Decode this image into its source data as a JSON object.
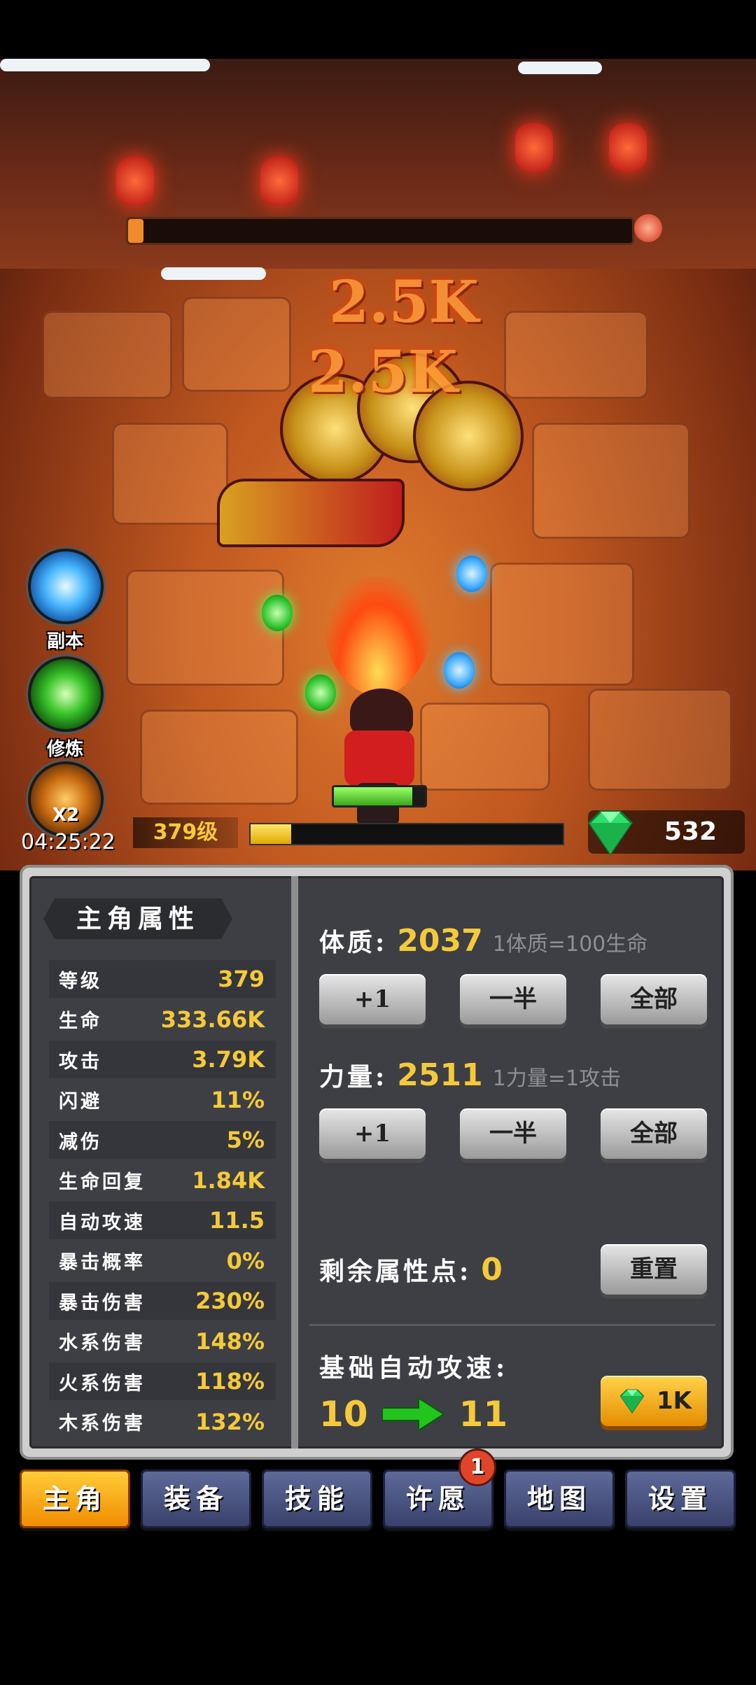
{
  "scene": {
    "damage_numbers": [
      "2.5K",
      "2.5K"
    ],
    "boss_hp_percent": 3,
    "hero_hp_percent": 86
  },
  "side_buttons": {
    "dungeon": {
      "label": "副本",
      "icon": "portal-icon"
    },
    "training": {
      "label": "修炼",
      "icon": "training-icon"
    },
    "double": {
      "badge": "X2",
      "icon": "treasure-pot-icon"
    }
  },
  "timer": "04:25:22",
  "level": {
    "label": "379级",
    "xp_percent": 13
  },
  "gems": {
    "value": "532",
    "icon": "green-gem-icon"
  },
  "stats_panel": {
    "title": "主角属性",
    "rows": [
      {
        "k": "等级",
        "v": "379"
      },
      {
        "k": "生命",
        "v": "333.66K"
      },
      {
        "k": "攻击",
        "v": "3.79K"
      },
      {
        "k": "闪避",
        "v": "11%"
      },
      {
        "k": "减伤",
        "v": "5%"
      },
      {
        "k": "生命回复",
        "v": "1.84K"
      },
      {
        "k": "自动攻速",
        "v": "11.5"
      },
      {
        "k": "暴击概率",
        "v": "0%"
      },
      {
        "k": "暴击伤害",
        "v": "230%"
      },
      {
        "k": "水系伤害",
        "v": "148%"
      },
      {
        "k": "火系伤害",
        "v": "118%"
      },
      {
        "k": "木系伤害",
        "v": "132%"
      }
    ]
  },
  "attributes": {
    "constitution": {
      "label": "体质:",
      "value": "2037",
      "hint": "1体质=100生命"
    },
    "strength": {
      "label": "力量:",
      "value": "2511",
      "hint": "1力量=1攻击"
    },
    "buttons": {
      "plus_one": "+1",
      "half": "一半",
      "all": "全部"
    },
    "remaining_label": "剩余属性点:",
    "remaining_value": "0",
    "reset_label": "重置",
    "speed_title": "基础自动攻速:",
    "speed_from": "10",
    "speed_to": "11",
    "upgrade_cost": "1K"
  },
  "tabs": [
    {
      "label": "主角",
      "active": true
    },
    {
      "label": "装备"
    },
    {
      "label": "技能"
    },
    {
      "label": "许愿",
      "badge": "1"
    },
    {
      "label": "地图"
    },
    {
      "label": "设置"
    }
  ],
  "colors": {
    "accent_gold": "#f5c93a",
    "tab_active": "#f08a00",
    "tab_normal": "#38406a"
  }
}
